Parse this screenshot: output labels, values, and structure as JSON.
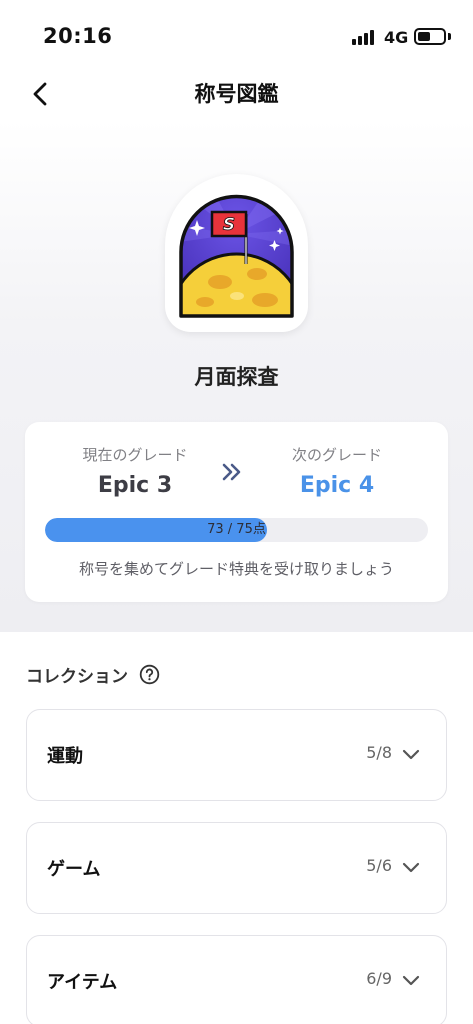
{
  "status_bar": {
    "time": "20:16",
    "network": "4G",
    "battery_level": 0.5
  },
  "header": {
    "title": "称号図鑑",
    "back_icon": "chevron-left-icon"
  },
  "badge": {
    "name": "月面探査",
    "flag_letter": "S",
    "colors": {
      "sky": "#5a3fd0",
      "moon": "#f5cf3a",
      "flag": "#e8333b",
      "outline": "#111111"
    }
  },
  "grade": {
    "current_label": "現在のグレード",
    "current_value": "Epic 3",
    "next_label": "次のグレード",
    "next_value": "Epic 4",
    "arrow_icon": "double-chevron-right-icon",
    "progress_text": "73 / 75点",
    "progress_fraction": 0.5797,
    "hint": "称号を集めてグレード特典を受け取りましょう",
    "accent_color": "#4a92e8"
  },
  "collection": {
    "title": "コレクション",
    "help_icon": "question-circle-icon",
    "categories": [
      {
        "label": "運動",
        "count": "5/8"
      },
      {
        "label": "ゲーム",
        "count": "5/6"
      },
      {
        "label": "アイテム",
        "count": "6/9"
      }
    ]
  }
}
